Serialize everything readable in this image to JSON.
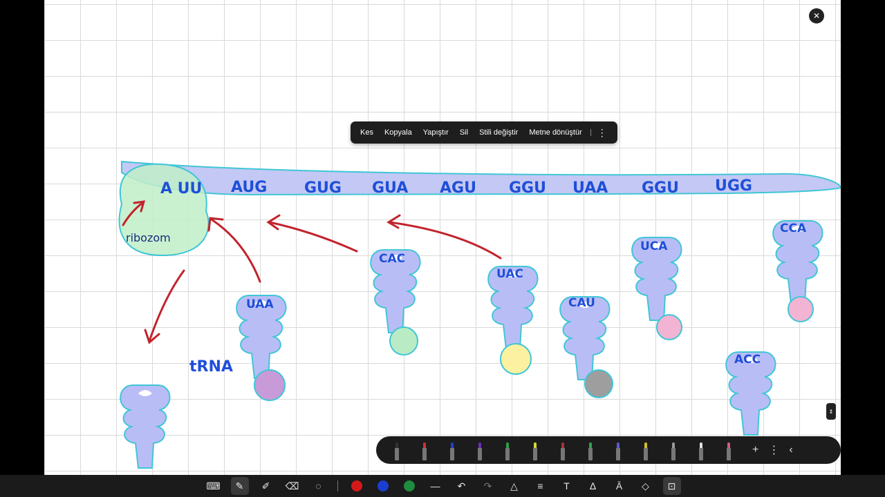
{
  "context_menu": {
    "items": [
      "Kes",
      "Kopyala",
      "Yapıştır",
      "Sil",
      "Stili değiştir",
      "Metne dönüştür"
    ]
  },
  "drawing": {
    "mrna_codons": [
      "A UU",
      "AUG",
      "GUG",
      "GUA",
      "AGU",
      "GGU",
      "UAA",
      "GGU",
      "UGG"
    ],
    "ribosome_label": "ribozom",
    "trna_label": "tRNA",
    "anticodons": [
      "UAA",
      "CAC",
      "UAC",
      "CAU",
      "UCA",
      "ACC",
      "CCA"
    ],
    "colors": {
      "mrna_fill": "#c4c8f4",
      "mrna_stroke": "#3fc6d6",
      "ribosome_fill": "#bfeec8",
      "arrow": "#c2232c",
      "trna_fill": "#b9bdf6",
      "ink": "#1f4fd8",
      "amino_green": "#b9ecc4",
      "amino_yellow": "#fbf1a0",
      "amino_purple": "#c99ad8",
      "amino_gray": "#9e9e9e",
      "amino_pink": "#f2b4d2"
    }
  },
  "pen_tray": {
    "pen_colors": [
      "#333333",
      "#d32f2f",
      "#1e40d0",
      "#6a2fb8",
      "#2e9d4a",
      "#d7d93a",
      "#b03030",
      "#31a050",
      "#5a5ad0",
      "#d0c030",
      "#9a9a9a",
      "#e0e0e0",
      "#d05a8a"
    ]
  },
  "toolbar": {
    "colors": [
      "#d31a1a",
      "#1a3fd0",
      "#1f8c3f"
    ]
  }
}
